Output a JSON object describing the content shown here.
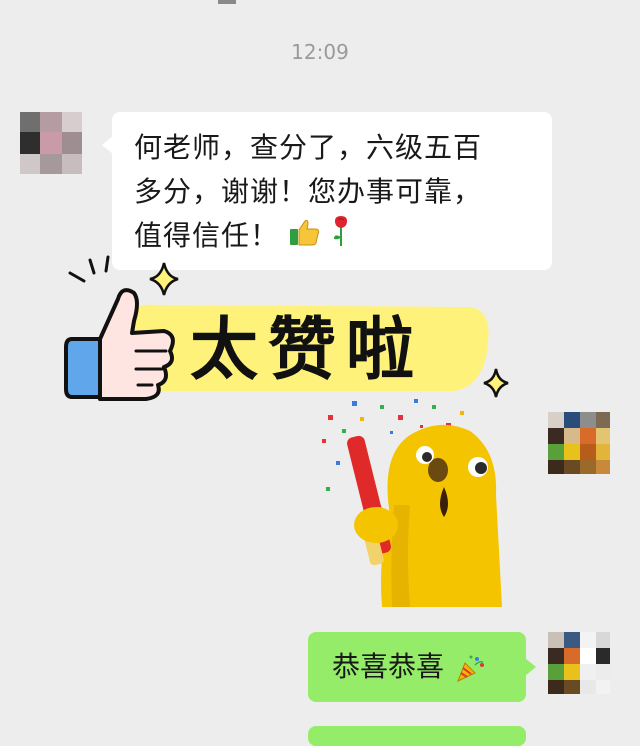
{
  "chat": {
    "timestamp": "12:09",
    "incoming_message": {
      "lines": [
        "何老师，查分了，六级五百",
        "多分，谢谢！您办事可靠，",
        "值得信任！"
      ],
      "emojis": [
        "thumbs-up-icon",
        "rose-icon"
      ]
    },
    "sticker": {
      "text": "太赞啦",
      "icons": [
        "thumbs-up-icon",
        "sparkle-icon",
        "party-popper-icon",
        "yellow-mascot"
      ]
    },
    "outgoing_message": {
      "text": "恭喜恭喜",
      "emoji": "party-popper-icon"
    }
  },
  "colors": {
    "background": "#ededed",
    "incoming_bubble": "#ffffff",
    "outgoing_bubble": "#95ec69",
    "timestamp": "#9a9a9a",
    "sticker_highlight": "#fff27a",
    "mascot_yellow": "#f5c400"
  }
}
